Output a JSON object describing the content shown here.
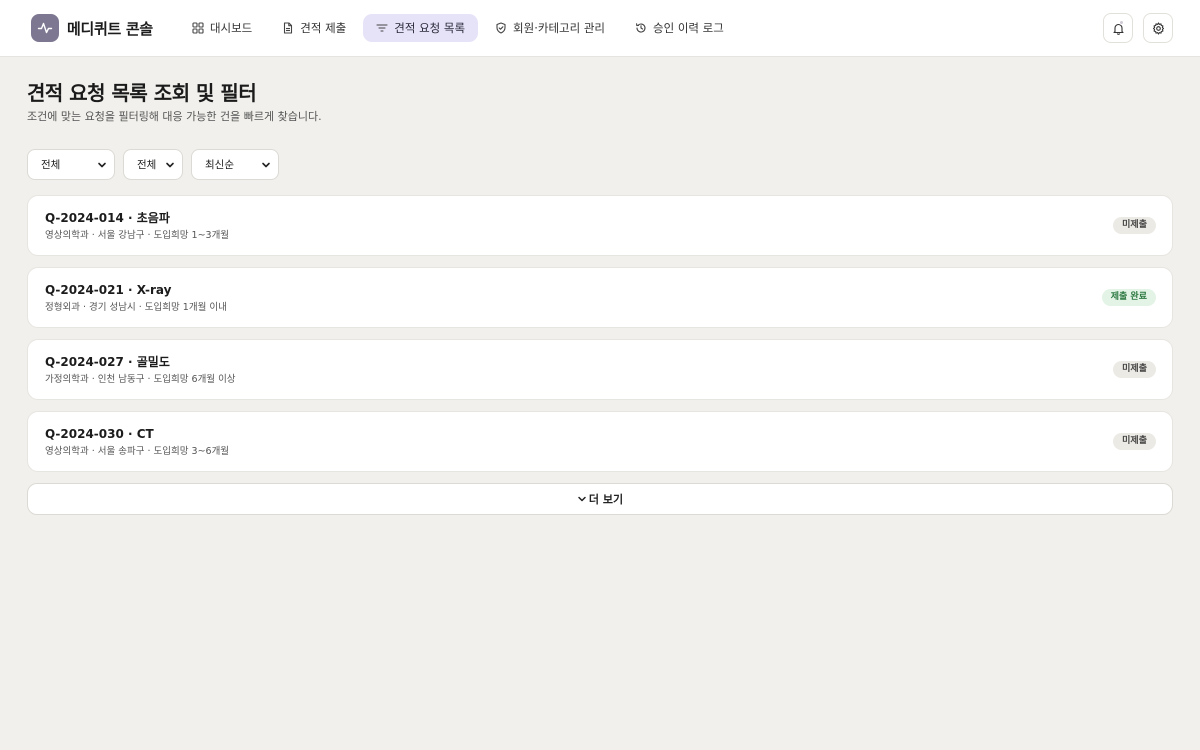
{
  "brand": {
    "name": "메디퀴트 콘솔",
    "accent": "#7d7791"
  },
  "nav": [
    {
      "label": "대시보드",
      "icon": "grid-icon",
      "active": false
    },
    {
      "label": "견적 제출",
      "icon": "document-icon",
      "active": false
    },
    {
      "label": "견적 요청 목록",
      "icon": "filter-icon",
      "active": true
    },
    {
      "label": "회원·카테고리 관리",
      "icon": "shield-icon",
      "active": false
    },
    {
      "label": "승인 이력 로그",
      "icon": "history-icon",
      "active": false
    }
  ],
  "page": {
    "title": "견적 요청 목록 조회 및 필터",
    "subtitle": "조건에 맞는 요청을 필터링해 대응 가능한 건을 빠르게 찾습니다."
  },
  "filters": [
    {
      "value": "전체"
    },
    {
      "value": "전체"
    },
    {
      "value": "최신순"
    }
  ],
  "requests": [
    {
      "title": "Q-2024-014 · 초음파",
      "meta": "영상의학과 · 서울 강남구 · 도입희망 1~3개월",
      "status": "미제출",
      "status_type": "pending"
    },
    {
      "title": "Q-2024-021 · X-ray",
      "meta": "정형외과 · 경기 성남시 · 도입희망 1개월 이내",
      "status": "제출 완료",
      "status_type": "done"
    },
    {
      "title": "Q-2024-027 · 골밀도",
      "meta": "가정의학과 · 인천 남동구 · 도입희망 6개월 이상",
      "status": "미제출",
      "status_type": "pending"
    },
    {
      "title": "Q-2024-030 · CT",
      "meta": "영상의학과 · 서울 송파구 · 도입희망 3~6개월",
      "status": "미제출",
      "status_type": "pending"
    }
  ],
  "more_label": "더 보기",
  "colors": {
    "background": "#f1f0ec",
    "active_nav": "#e6e3f8",
    "badge_done": "#2e7a43"
  }
}
